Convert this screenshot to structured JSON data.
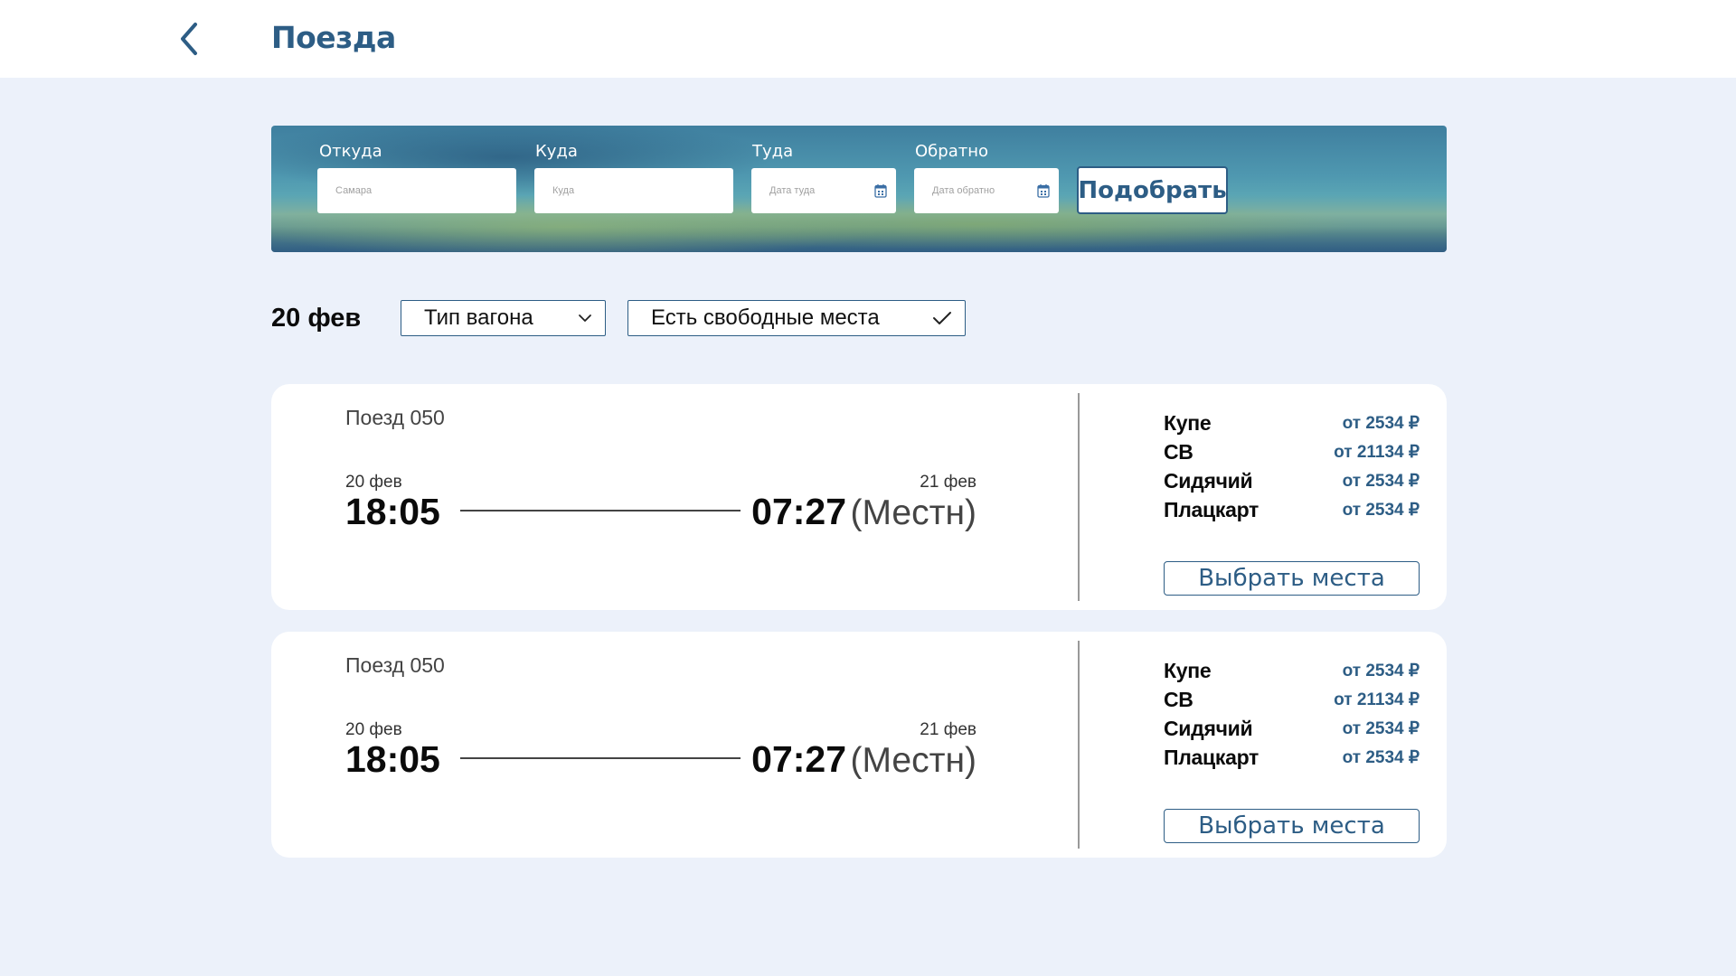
{
  "header": {
    "title": "Поезда"
  },
  "search": {
    "from_label": "Откуда",
    "from_placeholder": "Самара",
    "to_label": "Куда",
    "to_placeholder": "Куда",
    "there_label": "Туда",
    "there_placeholder": "Дата туда",
    "back_label": "Обратно",
    "back_placeholder": "Дата обратно",
    "submit_label": "Подобрать"
  },
  "filters": {
    "date": "20 фев",
    "car_type": "Тип вагона",
    "available": "Есть свободные места"
  },
  "trains": [
    {
      "name": "Поезд 050",
      "dep_date": "20 фев",
      "dep_time": "18:05",
      "arr_date": "21 фев",
      "arr_time": "07:27",
      "arr_note": "(Местн)",
      "classes": [
        {
          "name": "Купе",
          "price": "от 2534 ₽"
        },
        {
          "name": "СВ",
          "price": "от 21134 ₽"
        },
        {
          "name": "Сидячий",
          "price": "от 2534 ₽"
        },
        {
          "name": "Плацкарт",
          "price": "от 2534 ₽"
        }
      ],
      "select_label": "Выбрать места"
    },
    {
      "name": "Поезд 050",
      "dep_date": "20 фев",
      "dep_time": "18:05",
      "arr_date": "21 фев",
      "arr_time": "07:27",
      "arr_note": "(Местн)",
      "classes": [
        {
          "name": "Купе",
          "price": "от 2534 ₽"
        },
        {
          "name": "СВ",
          "price": "от 21134 ₽"
        },
        {
          "name": "Сидячий",
          "price": "от 2534 ₽"
        },
        {
          "name": "Плацкарт",
          "price": "от 2534 ₽"
        }
      ],
      "select_label": "Выбрать места"
    }
  ],
  "colors": {
    "accent": "#2d5d85",
    "background": "#ecf1fa",
    "card": "#ffffff"
  },
  "icons": {
    "back": "chevron-left-icon",
    "calendar": "calendar-icon",
    "dropdown": "chevron-down-icon",
    "check": "check-icon"
  }
}
